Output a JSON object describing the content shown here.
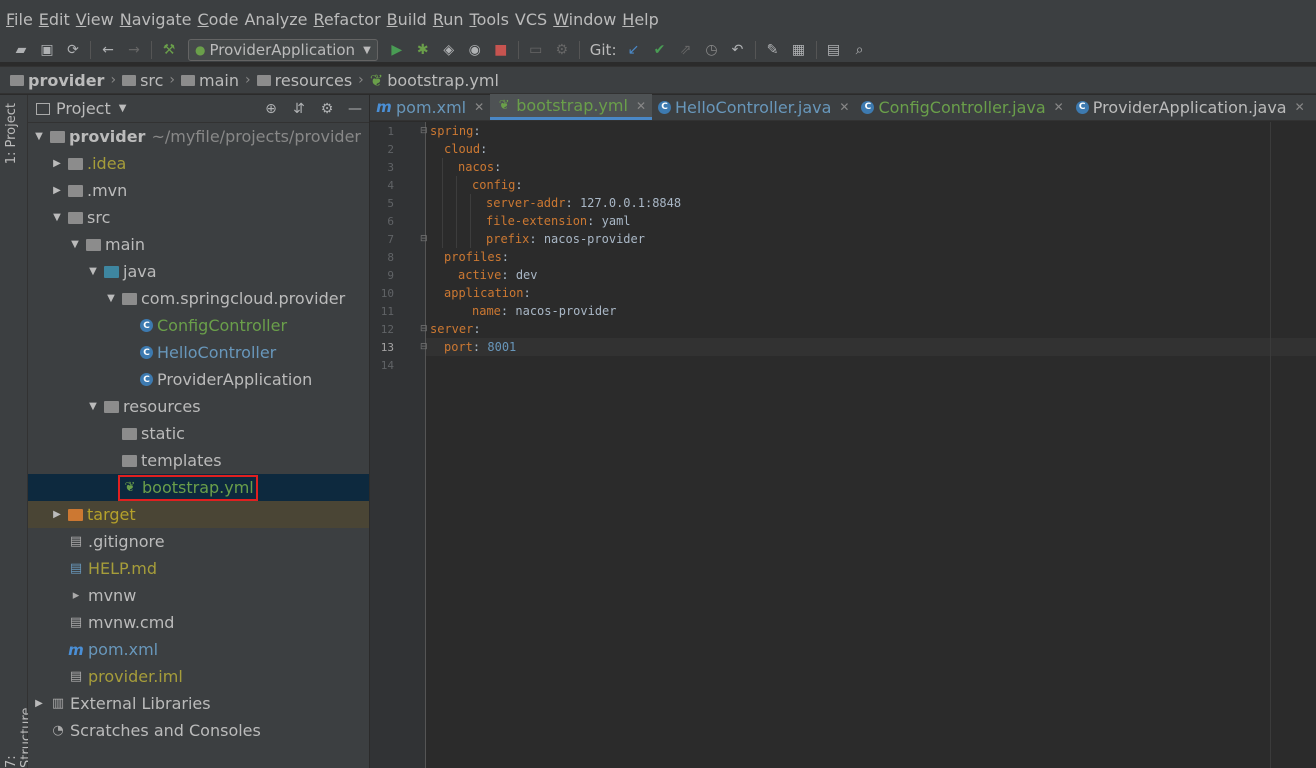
{
  "menu": [
    {
      "m": "F",
      "rest": "ile"
    },
    {
      "m": "E",
      "rest": "dit"
    },
    {
      "m": "V",
      "rest": "iew"
    },
    {
      "m": "N",
      "rest": "avigate"
    },
    {
      "m": "C",
      "rest": "ode"
    },
    {
      "m": "",
      "rest": "Analyze"
    },
    {
      "m": "R",
      "rest": "efactor"
    },
    {
      "m": "B",
      "rest": "uild"
    },
    {
      "m": "R",
      "rest": "un"
    },
    {
      "m": "T",
      "rest": "ools"
    },
    {
      "m": "",
      "rest": "VCS"
    },
    {
      "m": "W",
      "rest": "indow"
    },
    {
      "m": "H",
      "rest": "elp"
    }
  ],
  "toolbar": {
    "run_config": "ProviderApplication",
    "git_label": "Git:"
  },
  "breadcrumb": [
    "provider",
    "src",
    "main",
    "resources",
    "bootstrap.yml"
  ],
  "left_strip": {
    "project_tab": "1: Project",
    "structure_tab": "7: Structure"
  },
  "project_panel": {
    "title": "Project"
  },
  "tree": [
    {
      "label": "provider",
      "extra": "~/myfile/projects/provider"
    },
    {
      "label": ".idea"
    },
    {
      "label": ".mvn"
    },
    {
      "label": "src"
    },
    {
      "label": "main"
    },
    {
      "label": "java"
    },
    {
      "label": "com.springcloud.provider"
    },
    {
      "label": "ConfigController"
    },
    {
      "label": "HelloController"
    },
    {
      "label": "ProviderApplication"
    },
    {
      "label": "resources"
    },
    {
      "label": "static"
    },
    {
      "label": "templates"
    },
    {
      "label": "bootstrap.yml"
    },
    {
      "label": "target"
    },
    {
      "label": ".gitignore"
    },
    {
      "label": "HELP.md"
    },
    {
      "label": "mvnw"
    },
    {
      "label": "mvnw.cmd"
    },
    {
      "label": "pom.xml"
    },
    {
      "label": "provider.iml"
    },
    {
      "label": "External Libraries"
    },
    {
      "label": "Scratches and Consoles"
    }
  ],
  "tabs": [
    "pom.xml",
    "bootstrap.yml",
    "HelloController.java",
    "ConfigController.java",
    "ProviderApplication.java"
  ],
  "line_numbers": [
    "1",
    "2",
    "3",
    "4",
    "5",
    "6",
    "7",
    "8",
    "9",
    "10",
    "11",
    "12",
    "13",
    "14"
  ],
  "code": [
    {
      "key": "spring",
      "sep": ":",
      "val": ""
    },
    {
      "key": "cloud",
      "sep": ":",
      "val": ""
    },
    {
      "key": "nacos",
      "sep": ":",
      "val": ""
    },
    {
      "key": "config",
      "sep": ":",
      "val": ""
    },
    {
      "key": "server-addr",
      "sep": ":",
      "val": " 127.0.0.1:8848"
    },
    {
      "key": "file-extension",
      "sep": ":",
      "val": " yaml"
    },
    {
      "key": "prefix",
      "sep": ":",
      "val": " nacos-provider"
    },
    {
      "key": "profiles",
      "sep": ":",
      "val": ""
    },
    {
      "key": "active",
      "sep": ":",
      "val": " dev"
    },
    {
      "key": "application",
      "sep": ":",
      "val": ""
    },
    {
      "key": "name",
      "sep": ":",
      "val": " nacos-provider"
    },
    {
      "key": "server",
      "sep": ":",
      "val": ""
    },
    {
      "key": "port",
      "sep": ":",
      "val": " 8001"
    },
    {
      "key": "",
      "sep": "",
      "val": ""
    }
  ]
}
